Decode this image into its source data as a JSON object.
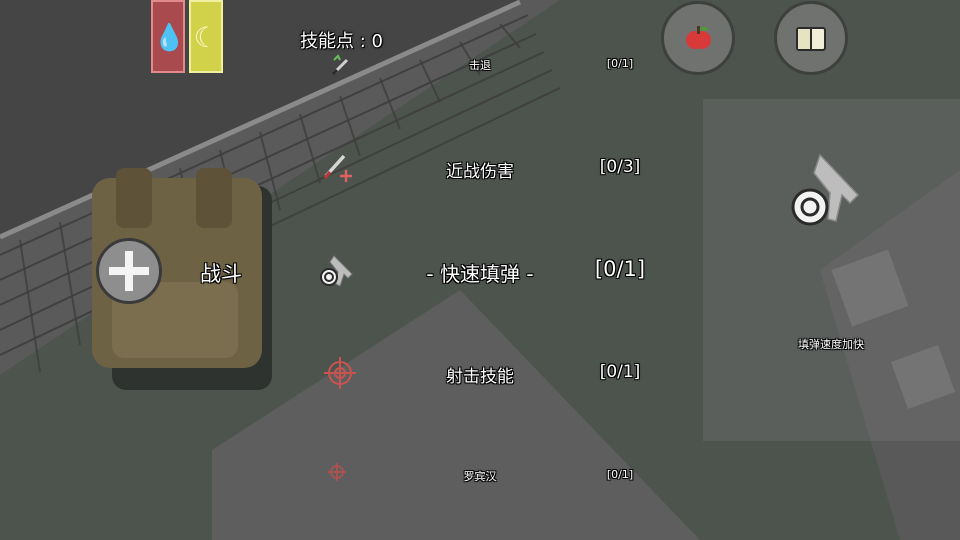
{
  "hud": {
    "skill_points_label": "技能点 : 0",
    "blood_icon": "blood-drop-icon",
    "food_icon": "banana-icon",
    "colors": {
      "blood_bar": "#b24a4f",
      "food_bar": "#d6d64a",
      "button_gray": "#6f726f"
    }
  },
  "buttons": {
    "food_button_icon": "apple-icon",
    "journal_button_icon": "book-icon",
    "add_icon": "plus-icon"
  },
  "category": {
    "label": "战斗"
  },
  "skills": [
    {
      "icon": "knife-arrow-icon",
      "name": "击退",
      "level": "[0/1]"
    },
    {
      "icon": "knife-plus-icon",
      "name": "近战伤害",
      "level": "[0/3]"
    },
    {
      "icon": "pistol-reload-icon",
      "name": "- 快速填弹 -",
      "level": "[0/1]",
      "selected": true
    },
    {
      "icon": "crosshair-icon",
      "name": "射击技能",
      "level": "[0/1]"
    },
    {
      "icon": "small-crosshair-icon",
      "name": "罗宾汉",
      "level": "[0/1]"
    }
  ],
  "detail": {
    "icon": "pistol-reload-icon",
    "description": "填弹速度加快"
  }
}
